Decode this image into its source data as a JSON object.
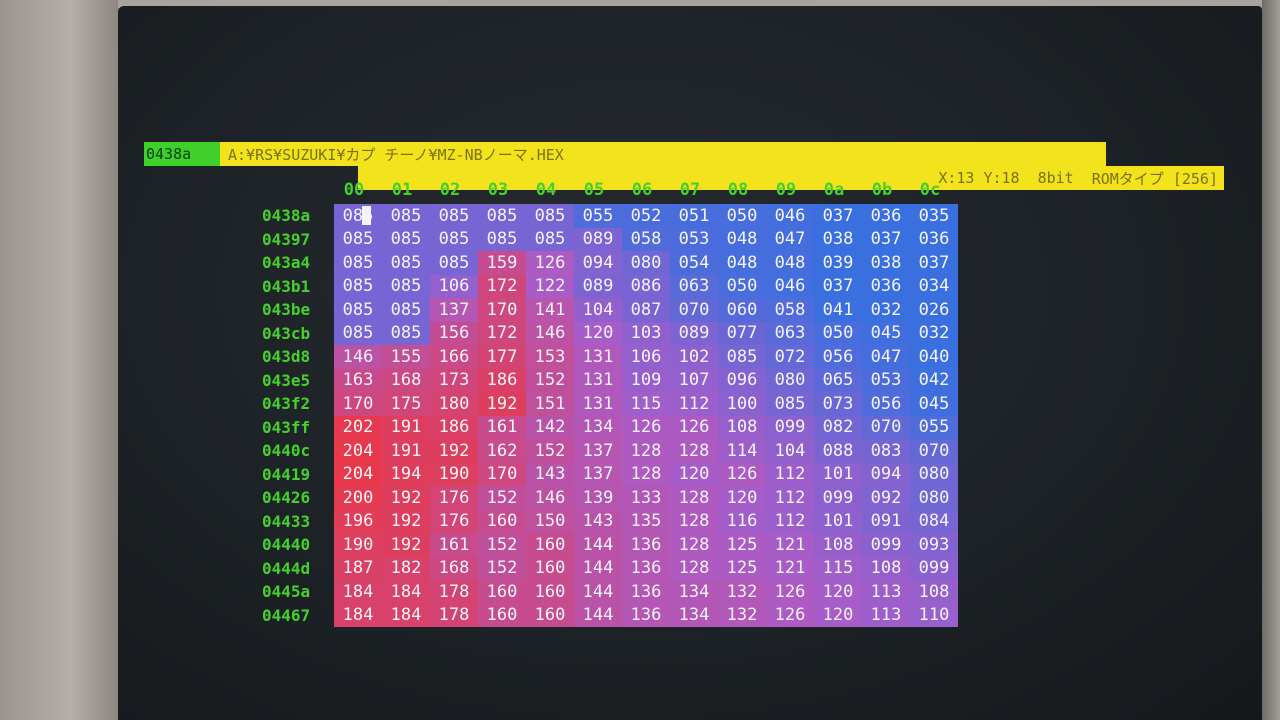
{
  "titlebar": {
    "address": "0438a",
    "path": "A:¥RS¥SUZUKI¥カプ チーノ¥MZ-NBノーマ.HEX"
  },
  "status": {
    "xy": "X:13 Y:18",
    "bits": "8bit",
    "rom_type": "ROMタイプ [256]"
  },
  "columns": [
    "00",
    "01",
    "02",
    "03",
    "04",
    "05",
    "06",
    "07",
    "08",
    "09",
    "0a",
    "0b",
    "0c"
  ],
  "rows": [
    {
      "addr": "0438a",
      "cells": [
        "085",
        "085",
        "085",
        "085",
        "085",
        "055",
        "052",
        "051",
        "050",
        "046",
        "037",
        "036",
        "035"
      ]
    },
    {
      "addr": "04397",
      "cells": [
        "085",
        "085",
        "085",
        "085",
        "085",
        "089",
        "058",
        "053",
        "048",
        "047",
        "038",
        "037",
        "036"
      ]
    },
    {
      "addr": "043a4",
      "cells": [
        "085",
        "085",
        "085",
        "159",
        "126",
        "094",
        "080",
        "054",
        "048",
        "048",
        "039",
        "038",
        "037"
      ]
    },
    {
      "addr": "043b1",
      "cells": [
        "085",
        "085",
        "106",
        "172",
        "122",
        "089",
        "086",
        "063",
        "050",
        "046",
        "037",
        "036",
        "034"
      ]
    },
    {
      "addr": "043be",
      "cells": [
        "085",
        "085",
        "137",
        "170",
        "141",
        "104",
        "087",
        "070",
        "060",
        "058",
        "041",
        "032",
        "026"
      ]
    },
    {
      "addr": "043cb",
      "cells": [
        "085",
        "085",
        "156",
        "172",
        "146",
        "120",
        "103",
        "089",
        "077",
        "063",
        "050",
        "045",
        "032"
      ]
    },
    {
      "addr": "043d8",
      "cells": [
        "146",
        "155",
        "166",
        "177",
        "153",
        "131",
        "106",
        "102",
        "085",
        "072",
        "056",
        "047",
        "040"
      ]
    },
    {
      "addr": "043e5",
      "cells": [
        "163",
        "168",
        "173",
        "186",
        "152",
        "131",
        "109",
        "107",
        "096",
        "080",
        "065",
        "053",
        "042"
      ]
    },
    {
      "addr": "043f2",
      "cells": [
        "170",
        "175",
        "180",
        "192",
        "151",
        "131",
        "115",
        "112",
        "100",
        "085",
        "073",
        "056",
        "045"
      ]
    },
    {
      "addr": "043ff",
      "cells": [
        "202",
        "191",
        "186",
        "161",
        "142",
        "134",
        "126",
        "126",
        "108",
        "099",
        "082",
        "070",
        "055"
      ]
    },
    {
      "addr": "0440c",
      "cells": [
        "204",
        "191",
        "192",
        "162",
        "152",
        "137",
        "128",
        "128",
        "114",
        "104",
        "088",
        "083",
        "070"
      ]
    },
    {
      "addr": "04419",
      "cells": [
        "204",
        "194",
        "190",
        "170",
        "143",
        "137",
        "128",
        "120",
        "126",
        "112",
        "101",
        "094",
        "080"
      ]
    },
    {
      "addr": "04426",
      "cells": [
        "200",
        "192",
        "176",
        "152",
        "146",
        "139",
        "133",
        "128",
        "120",
        "112",
        "099",
        "092",
        "080"
      ]
    },
    {
      "addr": "04433",
      "cells": [
        "196",
        "192",
        "176",
        "160",
        "150",
        "143",
        "135",
        "128",
        "116",
        "112",
        "101",
        "091",
        "084"
      ]
    },
    {
      "addr": "04440",
      "cells": [
        "190",
        "192",
        "161",
        "152",
        "160",
        "144",
        "136",
        "128",
        "125",
        "121",
        "108",
        "099",
        "093"
      ]
    },
    {
      "addr": "0444d",
      "cells": [
        "187",
        "182",
        "168",
        "152",
        "160",
        "144",
        "136",
        "128",
        "125",
        "121",
        "115",
        "108",
        "099"
      ]
    },
    {
      "addr": "0445a",
      "cells": [
        "184",
        "184",
        "178",
        "160",
        "160",
        "144",
        "136",
        "134",
        "132",
        "126",
        "120",
        "113",
        "108"
      ]
    },
    {
      "addr": "04467",
      "cells": [
        "184",
        "184",
        "178",
        "160",
        "160",
        "144",
        "136",
        "134",
        "132",
        "126",
        "120",
        "113",
        "110"
      ]
    }
  ],
  "colors": {
    "accent_green": "#46d02e",
    "path_yellow": "#f2e31c",
    "heat_low": "#3a6fe0",
    "heat_high": "#e8384a"
  }
}
